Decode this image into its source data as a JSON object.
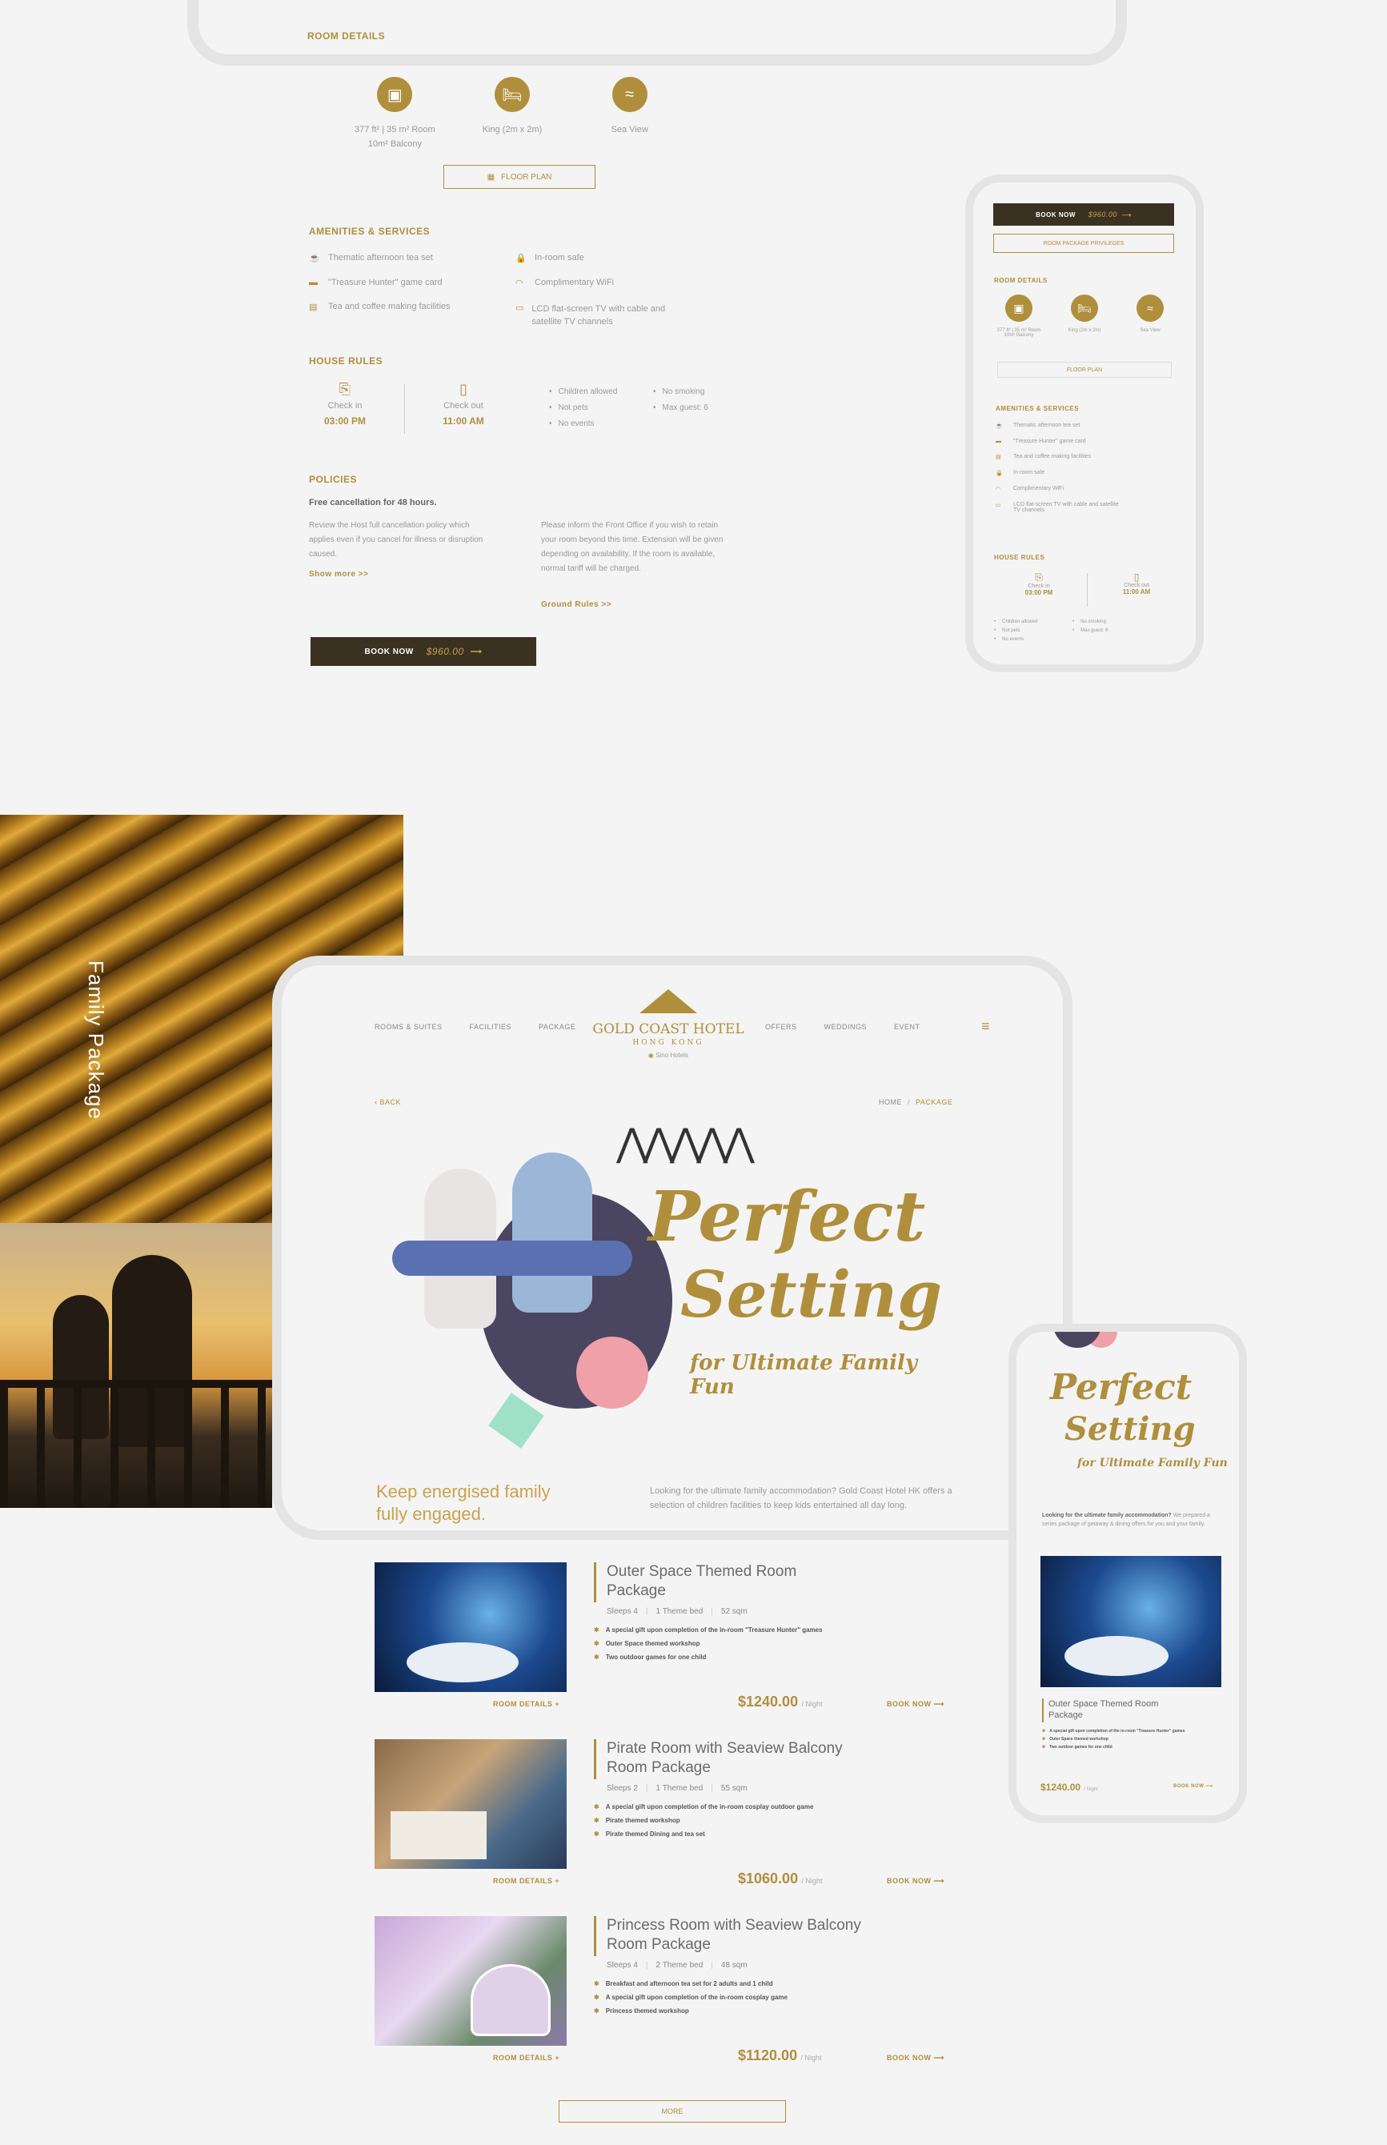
{
  "room_details": {
    "title": "ROOM DETAILS",
    "features": [
      {
        "icon": "room-size-icon",
        "line1": "377 ft² | 35 m² Room",
        "line2": "10m² Balcony"
      },
      {
        "icon": "bed-icon",
        "line1": "King (2m x 2m)",
        "line2": ""
      },
      {
        "icon": "sea-view-icon",
        "line1": "Sea View",
        "line2": ""
      }
    ],
    "floor_plan": "FLOOR PLAN"
  },
  "amenities": {
    "title": "AMENITIES & SERVICES",
    "left": [
      {
        "icon": "teacup-icon",
        "label": "Thematic afternoon tea set"
      },
      {
        "icon": "card-icon",
        "label": "\"Treasure Hunter\" game card"
      },
      {
        "icon": "kettle-icon",
        "label": "Tea and coffee making facilities"
      }
    ],
    "right": [
      {
        "icon": "lock-icon",
        "label": "In-room safe"
      },
      {
        "icon": "wifi-icon",
        "label": "Complimentary WiFi"
      },
      {
        "icon": "tv-icon",
        "label": "LCD flat-screen TV with cable and satellite TV channels"
      }
    ]
  },
  "house_rules": {
    "title": "HOUSE RULES",
    "check_in_label": "Check in",
    "check_in_time": "03:00 PM",
    "check_out_label": "Check out",
    "check_out_time": "11:00 AM",
    "rules_left": [
      "Children allowed",
      "Not pets",
      "No events"
    ],
    "rules_right": [
      "No smoking",
      "Max guest: 6"
    ]
  },
  "policies": {
    "title": "POLICIES",
    "headline": "Free cancellation for 48 hours.",
    "left_text": "Review the Host full cancellation policy which applies even if you cancel for illness or disruption caused.",
    "show_more": "Show more >>",
    "right_text": "Please inform the Front Office if you wish to retain your room beyond this time. Extension will be given depending on availability. If the room is available, normal tariff will be charged.",
    "ground_rules": "Ground Rules >>"
  },
  "book_now": {
    "label": "BOOK NOW",
    "price": "$960.00"
  },
  "mobile1": {
    "book_label": "BOOK NOW",
    "price": "$960.00",
    "privileges": "ROOM PACKAGE PRIVILEGES",
    "room_details": "ROOM DETAILS",
    "features": [
      "377 ft² | 35 m² Room 10m² Balcony",
      "King (2m x 2m)",
      "Sea View"
    ],
    "floor_plan": "FLOOR PLAN",
    "amenities_title": "AMENITIES & SERVICES",
    "amenities": [
      "Thematic afternoon tea set",
      "\"Treasure Hunter\" game card",
      "Tea and coffee making facilities",
      "In-room safe",
      "Complimentary WiFi",
      "LCD flat-screen TV with cable and satellite TV channels"
    ],
    "house_rules": "HOUSE RULES",
    "check_in_label": "Check in",
    "check_in_time": "03:00 PM",
    "check_out_label": "Check out",
    "check_out_time": "11:00 AM",
    "rules_left": [
      "Children allowed",
      "Not pets",
      "No events"
    ],
    "rules_right": [
      "No smoking",
      "Max guest: 6"
    ]
  },
  "side_label": "Family Package",
  "header": {
    "nav_left": [
      "ROOMS & SUITES",
      "FACILITIES",
      "PACKAGE"
    ],
    "nav_right": [
      "OFFERS",
      "WEDDINGS",
      "EVENT"
    ],
    "logo_main": "GOLD COAST HOTEL",
    "logo_sub": "HONG KONG",
    "logo_group": "Sino Hotels"
  },
  "breadcrumb": {
    "back": "BACK",
    "home": "HOME",
    "sep": "/",
    "current": "PACKAGE"
  },
  "hero": {
    "line1": "Perfect",
    "line2": "Setting",
    "line3": "for Ultimate Family Fun",
    "tagline": "Keep energised family fully engaged.",
    "intro": "Looking for the ultimate family accommodation? Gold Coast Hotel HK offers a selection of children facilities to keep kids entertained all day long."
  },
  "packages": [
    {
      "title": "Outer Space Themed Room Package",
      "sleeps": "Sleeps 4",
      "bed": "1 Theme bed",
      "size": "52 sqm",
      "bullets": [
        "A special gift upon completion of the in-room \"Treasure Hunter\" games",
        "Outer Space themed workshop",
        "Two outdoor games for one child"
      ],
      "details": "ROOM DETAILS +",
      "price": "$1240.00",
      "per": "/ Night",
      "book": "BOOK NOW"
    },
    {
      "title": "Pirate Room with Seaview Balcony Room Package",
      "sleeps": "Sleeps 2",
      "bed": "1 Theme bed",
      "size": "55 sqm",
      "bullets": [
        "A special gift upon completion of the in-room cosplay outdoor game",
        "Pirate themed workshop",
        "Pirate themed Dining and tea set"
      ],
      "details": "ROOM DETAILS +",
      "price": "$1060.00",
      "per": "/ Night",
      "book": "BOOK NOW"
    },
    {
      "title": "Princess Room with Seaview Balcony Room Package",
      "sleeps": "Sleeps 4",
      "bed": "2 Theme bed",
      "size": "48 sqm",
      "bullets": [
        "Breakfast and afternoon tea set for 2 adults and 1 child",
        "A special gift upon completion of the in-room cosplay game",
        "Princess themed workshop"
      ],
      "details": "ROOM DETAILS +",
      "price": "$1120.00",
      "per": "/ Night",
      "book": "BOOK NOW"
    }
  ],
  "more": "MORE",
  "mobile2": {
    "line1": "Perfect",
    "line2": "Setting",
    "line3": "for Ultimate Family Fun",
    "intro_bold": "Looking for the ultimate family accommodation?",
    "intro": "We prepared a series package of getaway & dining offers for you and your family.",
    "pkg_title": "Outer Space Themed Room Package",
    "bullets": [
      "A special gift upon completion of the in-room \"Treasure Hunter\" games",
      "Outer Space themed workshop",
      "Two outdoor games for one child"
    ],
    "price": "$1240.00",
    "per": "/ Night",
    "book": "BOOK NOW"
  },
  "colors": {
    "gold": "#b08f3c",
    "dark": "#3a3120",
    "bg": "#f4f4f4",
    "frame": "#e4e4e4"
  }
}
